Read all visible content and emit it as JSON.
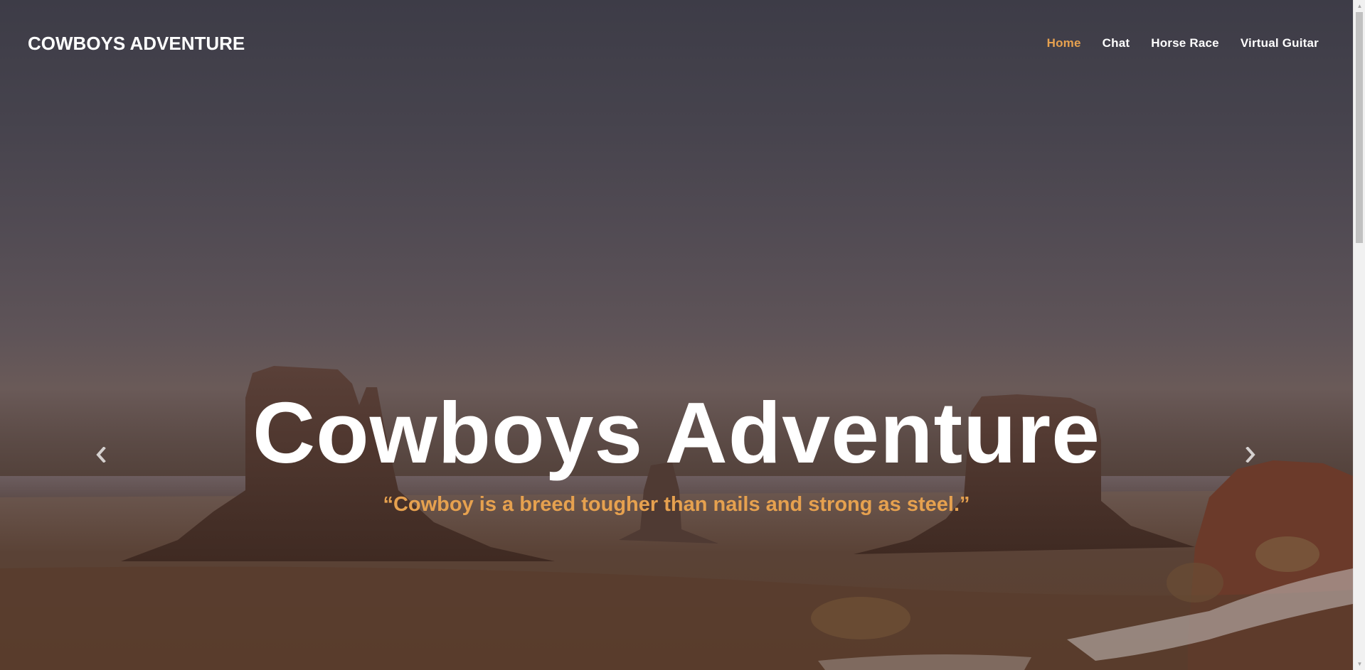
{
  "header": {
    "brand": "COWBOYS ADVENTURE",
    "nav": [
      {
        "label": "Home",
        "active": true
      },
      {
        "label": "Chat",
        "active": false
      },
      {
        "label": "Horse Race",
        "active": false
      },
      {
        "label": "Virtual Guitar",
        "active": false
      }
    ]
  },
  "hero": {
    "title": "Cowboys Adventure",
    "quote": "“Cowboy is a breed tougher than nails and strong as steel.”",
    "prev_icon": "chevron-left-icon",
    "next_icon": "chevron-right-icon"
  },
  "colors": {
    "accent": "#e6a14f",
    "text": "#ffffff"
  }
}
